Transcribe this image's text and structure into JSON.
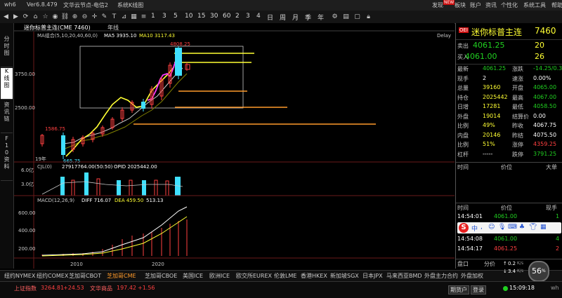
{
  "titlebar": {
    "app_name": "wh6",
    "version": "Ver6.8.479",
    "server": "文华云节点-电信2",
    "window": "系统K线图",
    "menus": [
      "发现",
      "板块",
      "账户",
      "资讯",
      "个性化",
      "系统工具",
      "帮助"
    ],
    "new_badge": "NEW"
  },
  "toolbar": {
    "periods": [
      "1",
      "3",
      "5",
      "10",
      "15",
      "30",
      "60",
      "2",
      "3",
      "4",
      "日",
      "周",
      "月",
      "季",
      "年"
    ]
  },
  "left_tabs": [
    "分时图",
    "K线图",
    "资讯链",
    "F10资料"
  ],
  "chart": {
    "tab_label": "迷你标普主连(CME 7460)",
    "period_label": "年线",
    "ma_label": "MA组合(5,10,20,40,60,0)",
    "ma5": "MA5 3935.10",
    "ma10": "MA10 3117.43",
    "delay": "Delay",
    "high_label": "4808.25",
    "low_label": "665.75",
    "prev_label": "1586.75",
    "y_ticks_price": [
      "3750.00",
      "2500.00"
    ],
    "year_label": "19年",
    "vol_label": "CJL(0)",
    "vol_values": "27917764.00(50:50)",
    "opid": "OPID 2025442.00",
    "vol_ticks": [
      "6.0亿",
      "3.0亿"
    ],
    "macd_label": "MACD(12,26,9)",
    "diff": "DIFF 716.07",
    "dea": "DEA 459.50",
    "macd_val": "513.13",
    "macd_ticks": [
      "600.00",
      "400.00",
      "200.00"
    ],
    "x_ticks": [
      "2010",
      "2020"
    ]
  },
  "right_panel": {
    "badge": "OEI",
    "name": "迷你标普主连",
    "code": "7460",
    "sell_label": "卖出",
    "sell_price": "4061.25",
    "sell_qty": "20",
    "buy_label": "买入",
    "buy_price": "4061.00",
    "buy_qty": "26",
    "rows": [
      {
        "l1": "最新",
        "v1": "4061.25",
        "c1": "green",
        "l2": "涨跌",
        "v2": "-14.25/0.35%",
        "c2": "green"
      },
      {
        "l1": "现手",
        "v1": "2",
        "c1": "white",
        "l2": "速涨",
        "v2": "0.00%",
        "c2": "white"
      },
      {
        "l1": "总量",
        "v1": "39160",
        "c1": "yellow",
        "l2": "开盘",
        "v2": "4065.00",
        "c2": "green"
      },
      {
        "l1": "持仓",
        "v1": "2025442",
        "c1": "yellow",
        "l2": "最高",
        "v2": "4067.00",
        "c2": "green"
      },
      {
        "l1": "日增",
        "v1": "17281",
        "c1": "yellow",
        "l2": "最低",
        "v2": "4058.50",
        "c2": "green"
      },
      {
        "l1": "外盘",
        "v1": "19014",
        "c1": "yellow",
        "l2": "结算价",
        "v2": "0.00",
        "c2": "white"
      },
      {
        "l1": "比例",
        "v1": "49%",
        "c1": "yellow",
        "l2": "昨收",
        "v2": "4067.75",
        "c2": "white"
      },
      {
        "l1": "内盘",
        "v1": "20146",
        "c1": "yellow",
        "l2": "昨结",
        "v2": "4075.50",
        "c2": "white"
      },
      {
        "l1": "比例",
        "v1": "51%",
        "c1": "yellow",
        "l2": "涨停",
        "v2": "4359.25",
        "c2": "red"
      },
      {
        "l1": "杠杆",
        "v1": "-----",
        "c1": "white",
        "l2": "跌停",
        "v2": "3791.25",
        "c2": "green"
      }
    ],
    "tick_headers": [
      "时间",
      "价位",
      "大单"
    ],
    "trade_headers": [
      "时间",
      "价位",
      "现手"
    ],
    "trades": [
      {
        "time": "14:54:01",
        "price": "4061.00",
        "qty": "1",
        "qc": "green"
      },
      {
        "time": "14:54:08",
        "price": "4061.00",
        "qty": "4",
        "qc": "green"
      },
      {
        "time": "14:54:17",
        "price": "4061.25",
        "qty": "2",
        "qc": "red"
      }
    ],
    "bottom_tab1": "盘口",
    "bottom_tab2": "分价"
  },
  "bottom_tabs": [
    "纽约NYMEX",
    "纽约COMEX",
    "芝加哥CBOT",
    "芝加哥CME",
    "芝加哥CBOE",
    "美国ICE",
    "欧洲ICE",
    "欧交所EUREX",
    "伦敦LME",
    "香港HKEX",
    "新加坡SGX",
    "日本JPX",
    "马来西亚BMD",
    "外盘主力合约",
    "外盘加权"
  ],
  "active_bottom_tab": 3,
  "status": {
    "sh_label": "上证指数",
    "sh_value": "3264.81",
    "sh_change": "+24.53",
    "commodity_label": "文华商品",
    "commodity_value": "197.42",
    "commodity_change": "+1.56",
    "account": "期货户",
    "sign_in": "登录",
    "clock": "15:09:18",
    "clock_suffix": "wh",
    "net_up": "0.2",
    "net_down": "3.4",
    "net_unit": "K/s",
    "pct": "56",
    "pct_sign": "%"
  },
  "colors": {
    "up": "#ff4040",
    "down": "#20d020",
    "accent": "#ffff33",
    "cyan": "#40e0ff",
    "magenta": "#ff3cff"
  }
}
